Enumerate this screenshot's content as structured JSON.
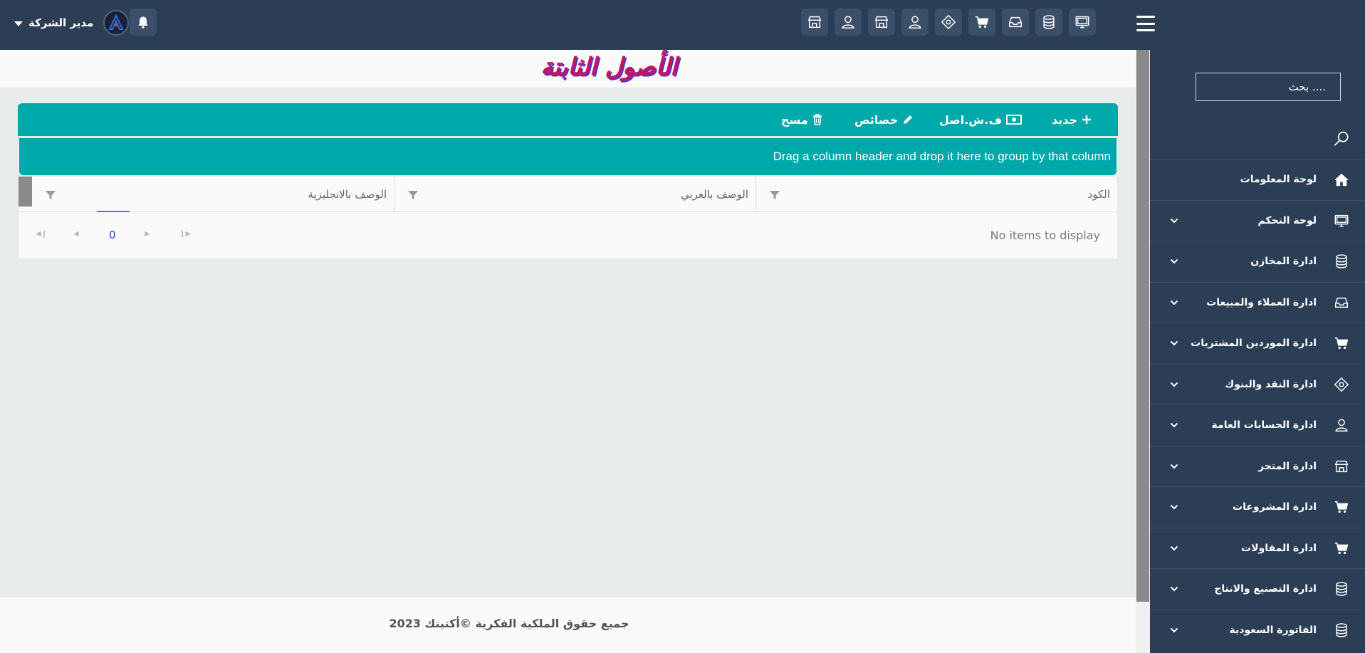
{
  "topbar": {
    "user_name": "مدير الشركة",
    "quick_icons": [
      "store-icon",
      "user-icon",
      "store-icon",
      "user-icon",
      "money-icon",
      "cart-icon",
      "inbox-icon",
      "database-icon",
      "monitor-icon"
    ]
  },
  "sidebar": {
    "search_placeholder": "بحث ....",
    "items": [
      {
        "label": "لوحة المعلومات",
        "icon": "home-icon",
        "has_children": false
      },
      {
        "label": "لوحة التحكم",
        "icon": "monitor-icon",
        "has_children": true
      },
      {
        "label": "ادارة المخازن",
        "icon": "database-icon",
        "has_children": true
      },
      {
        "label": "ادارة العملاء والمبيعات",
        "icon": "inbox-icon",
        "has_children": true
      },
      {
        "label": "ادارة الموردين المشتريات",
        "icon": "cart-icon",
        "has_children": true
      },
      {
        "label": "ادارة النقد والبنوك",
        "icon": "money-icon",
        "has_children": true
      },
      {
        "label": "ادارة الحسابات العامة",
        "icon": "user-icon",
        "has_children": true
      },
      {
        "label": "ادارة المتجر",
        "icon": "store-icon",
        "has_children": true
      },
      {
        "label": "ادارة المشروعات",
        "icon": "cart-icon",
        "has_children": true
      },
      {
        "label": "ادارة المقاولات",
        "icon": "cart-icon",
        "has_children": true
      },
      {
        "label": "ادارة التصنيع والانتاج",
        "icon": "database-icon",
        "has_children": true
      },
      {
        "label": "الفاتورة السعودية",
        "icon": "database-icon",
        "has_children": true
      }
    ]
  },
  "page": {
    "title": "الأصول الثابتة"
  },
  "toolbar": {
    "new_label": "جديد",
    "asset_card_label": "ف.ش.اصل",
    "properties_label": "خصائص",
    "delete_label": "مسح"
  },
  "grid": {
    "group_panel_text": "Drag a column header and drop it here to group by that column",
    "columns": [
      {
        "title": "الكود"
      },
      {
        "title": "الوصف بالعربي"
      },
      {
        "title": "الوصف بالانجليزية"
      }
    ],
    "empty_text": "No items to display",
    "current_page": "0"
  },
  "footer": {
    "copyright": "جميع حقوق الملكية الفكرية ©أكتيتك 2023"
  },
  "colors": {
    "topbar": "#2c3e55",
    "accent_teal": "#00a9a9",
    "title_pink": "#c2185b",
    "title_shadow": "#5b2dd6"
  }
}
